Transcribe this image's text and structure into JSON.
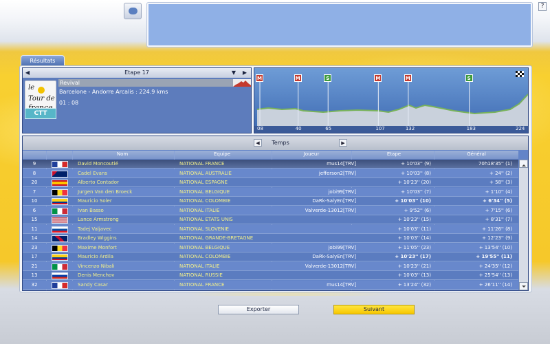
{
  "help_label": "?",
  "tabs": {
    "results": "Résultats"
  },
  "stage": {
    "label": "Etape 17",
    "name": "Revival",
    "route": "Barcelone - Andorre Arcalis : 224.9 kms",
    "time": "01 : 08",
    "logo": {
      "line1": "le",
      "line2": "Tour de",
      "line3": "france"
    },
    "type_badge": "CTT"
  },
  "profile": {
    "km_labels": [
      "08",
      "40",
      "65",
      "107",
      "132",
      "183",
      "224"
    ],
    "markers": [
      {
        "type": "M",
        "km": 8
      },
      {
        "type": "M",
        "km": 40
      },
      {
        "type": "S",
        "km": 65
      },
      {
        "type": "M",
        "km": 107
      },
      {
        "type": "M",
        "km": 132
      },
      {
        "type": "S",
        "km": 183
      }
    ],
    "colors": {
      "sky": "#4a7fc0",
      "hills": "#bcc6d2",
      "ridge": "#6aa84f"
    }
  },
  "table": {
    "title": "Temps",
    "headers": {
      "name": "Nom",
      "team": "Equipe",
      "player": "Joueur",
      "stage": "Etape",
      "general": "Général"
    },
    "rows": [
      {
        "rank": "9",
        "flag": "fr",
        "name": "David Moncoutié",
        "team": "NATIONAL FRANCE",
        "player": "mus14[TRV]",
        "stage": "+ 10'03'' (9)",
        "general": "70h18'35'' (1)",
        "selected": true
      },
      {
        "rank": "8",
        "flag": "au",
        "name": "Cadel Evans",
        "team": "NATIONAL AUSTRALIE",
        "player": "jefferson2[TRV]",
        "stage": "+ 10'03'' (8)",
        "general": "+ 24'' (2)"
      },
      {
        "rank": "20",
        "flag": "es",
        "name": "Alberto Contador",
        "team": "NATIONAL ESPAGNE",
        "player": "",
        "stage": "+ 10'23'' (20)",
        "general": "+ 58'' (3)"
      },
      {
        "rank": "7",
        "flag": "be",
        "name": "Jurgen Van den Broeck",
        "team": "NATIONAL BELGIQUE",
        "player": "jobi99[TRV]",
        "stage": "+ 10'03'' (7)",
        "general": "+ 1'10'' (4)"
      },
      {
        "rank": "10",
        "flag": "co",
        "name": "Mauricio Soler",
        "team": "NATIONAL COLOMBIE",
        "player": "DaRk-SalyEn[TRV]",
        "stage": "+ 10'03'' (10)",
        "general": "+ 6'34'' (5)",
        "bold": true
      },
      {
        "rank": "6",
        "flag": "it",
        "name": "Ivan Basso",
        "team": "NATIONAL ITALIE",
        "player": "Valverde-13012[TRV]",
        "stage": "+ 9'52'' (6)",
        "general": "+ 7'15'' (6)"
      },
      {
        "rank": "15",
        "flag": "us",
        "name": "Lance Armstrong",
        "team": "NATIONAL ETATS UNIS",
        "player": "",
        "stage": "+ 10'23'' (15)",
        "general": "+ 8'31'' (7)"
      },
      {
        "rank": "11",
        "flag": "si",
        "name": "Tadej Valjavec",
        "team": "NATIONAL SLOVENIE",
        "player": "",
        "stage": "+ 10'03'' (11)",
        "general": "+ 11'26'' (8)"
      },
      {
        "rank": "14",
        "flag": "gb",
        "name": "Bradley Wiggins",
        "team": "NATIONAL GRANDE-BRETAGNE",
        "player": "",
        "stage": "+ 10'03'' (14)",
        "general": "+ 12'23'' (9)"
      },
      {
        "rank": "23",
        "flag": "be",
        "name": "Maxime Monfort",
        "team": "NATIONAL BELGIQUE",
        "player": "jobi99[TRV]",
        "stage": "+ 11'05'' (23)",
        "general": "+ 13'54'' (10)"
      },
      {
        "rank": "17",
        "flag": "co",
        "name": "Mauricio Ardila",
        "team": "NATIONAL COLOMBIE",
        "player": "DaRk-SalyEn[TRV]",
        "stage": "+ 10'23'' (17)",
        "general": "+ 19'55'' (11)",
        "bold": true
      },
      {
        "rank": "21",
        "flag": "it",
        "name": "Vincenzo Nibali",
        "team": "NATIONAL ITALIE",
        "player": "Valverde-13012[TRV]",
        "stage": "+ 10'23'' (21)",
        "general": "+ 24'35'' (12)"
      },
      {
        "rank": "13",
        "flag": "ru",
        "name": "Denis Menchov",
        "team": "NATIONAL RUSSIE",
        "player": "",
        "stage": "+ 10'03'' (13)",
        "general": "+ 25'54'' (13)"
      },
      {
        "rank": "32",
        "flag": "fr",
        "name": "Sandy Casar",
        "team": "NATIONAL FRANCE",
        "player": "mus14[TRV]",
        "stage": "+ 13'24'' (32)",
        "general": "+ 26'11'' (14)"
      }
    ]
  },
  "buttons": {
    "export": "Exporter",
    "next": "Suivant"
  }
}
